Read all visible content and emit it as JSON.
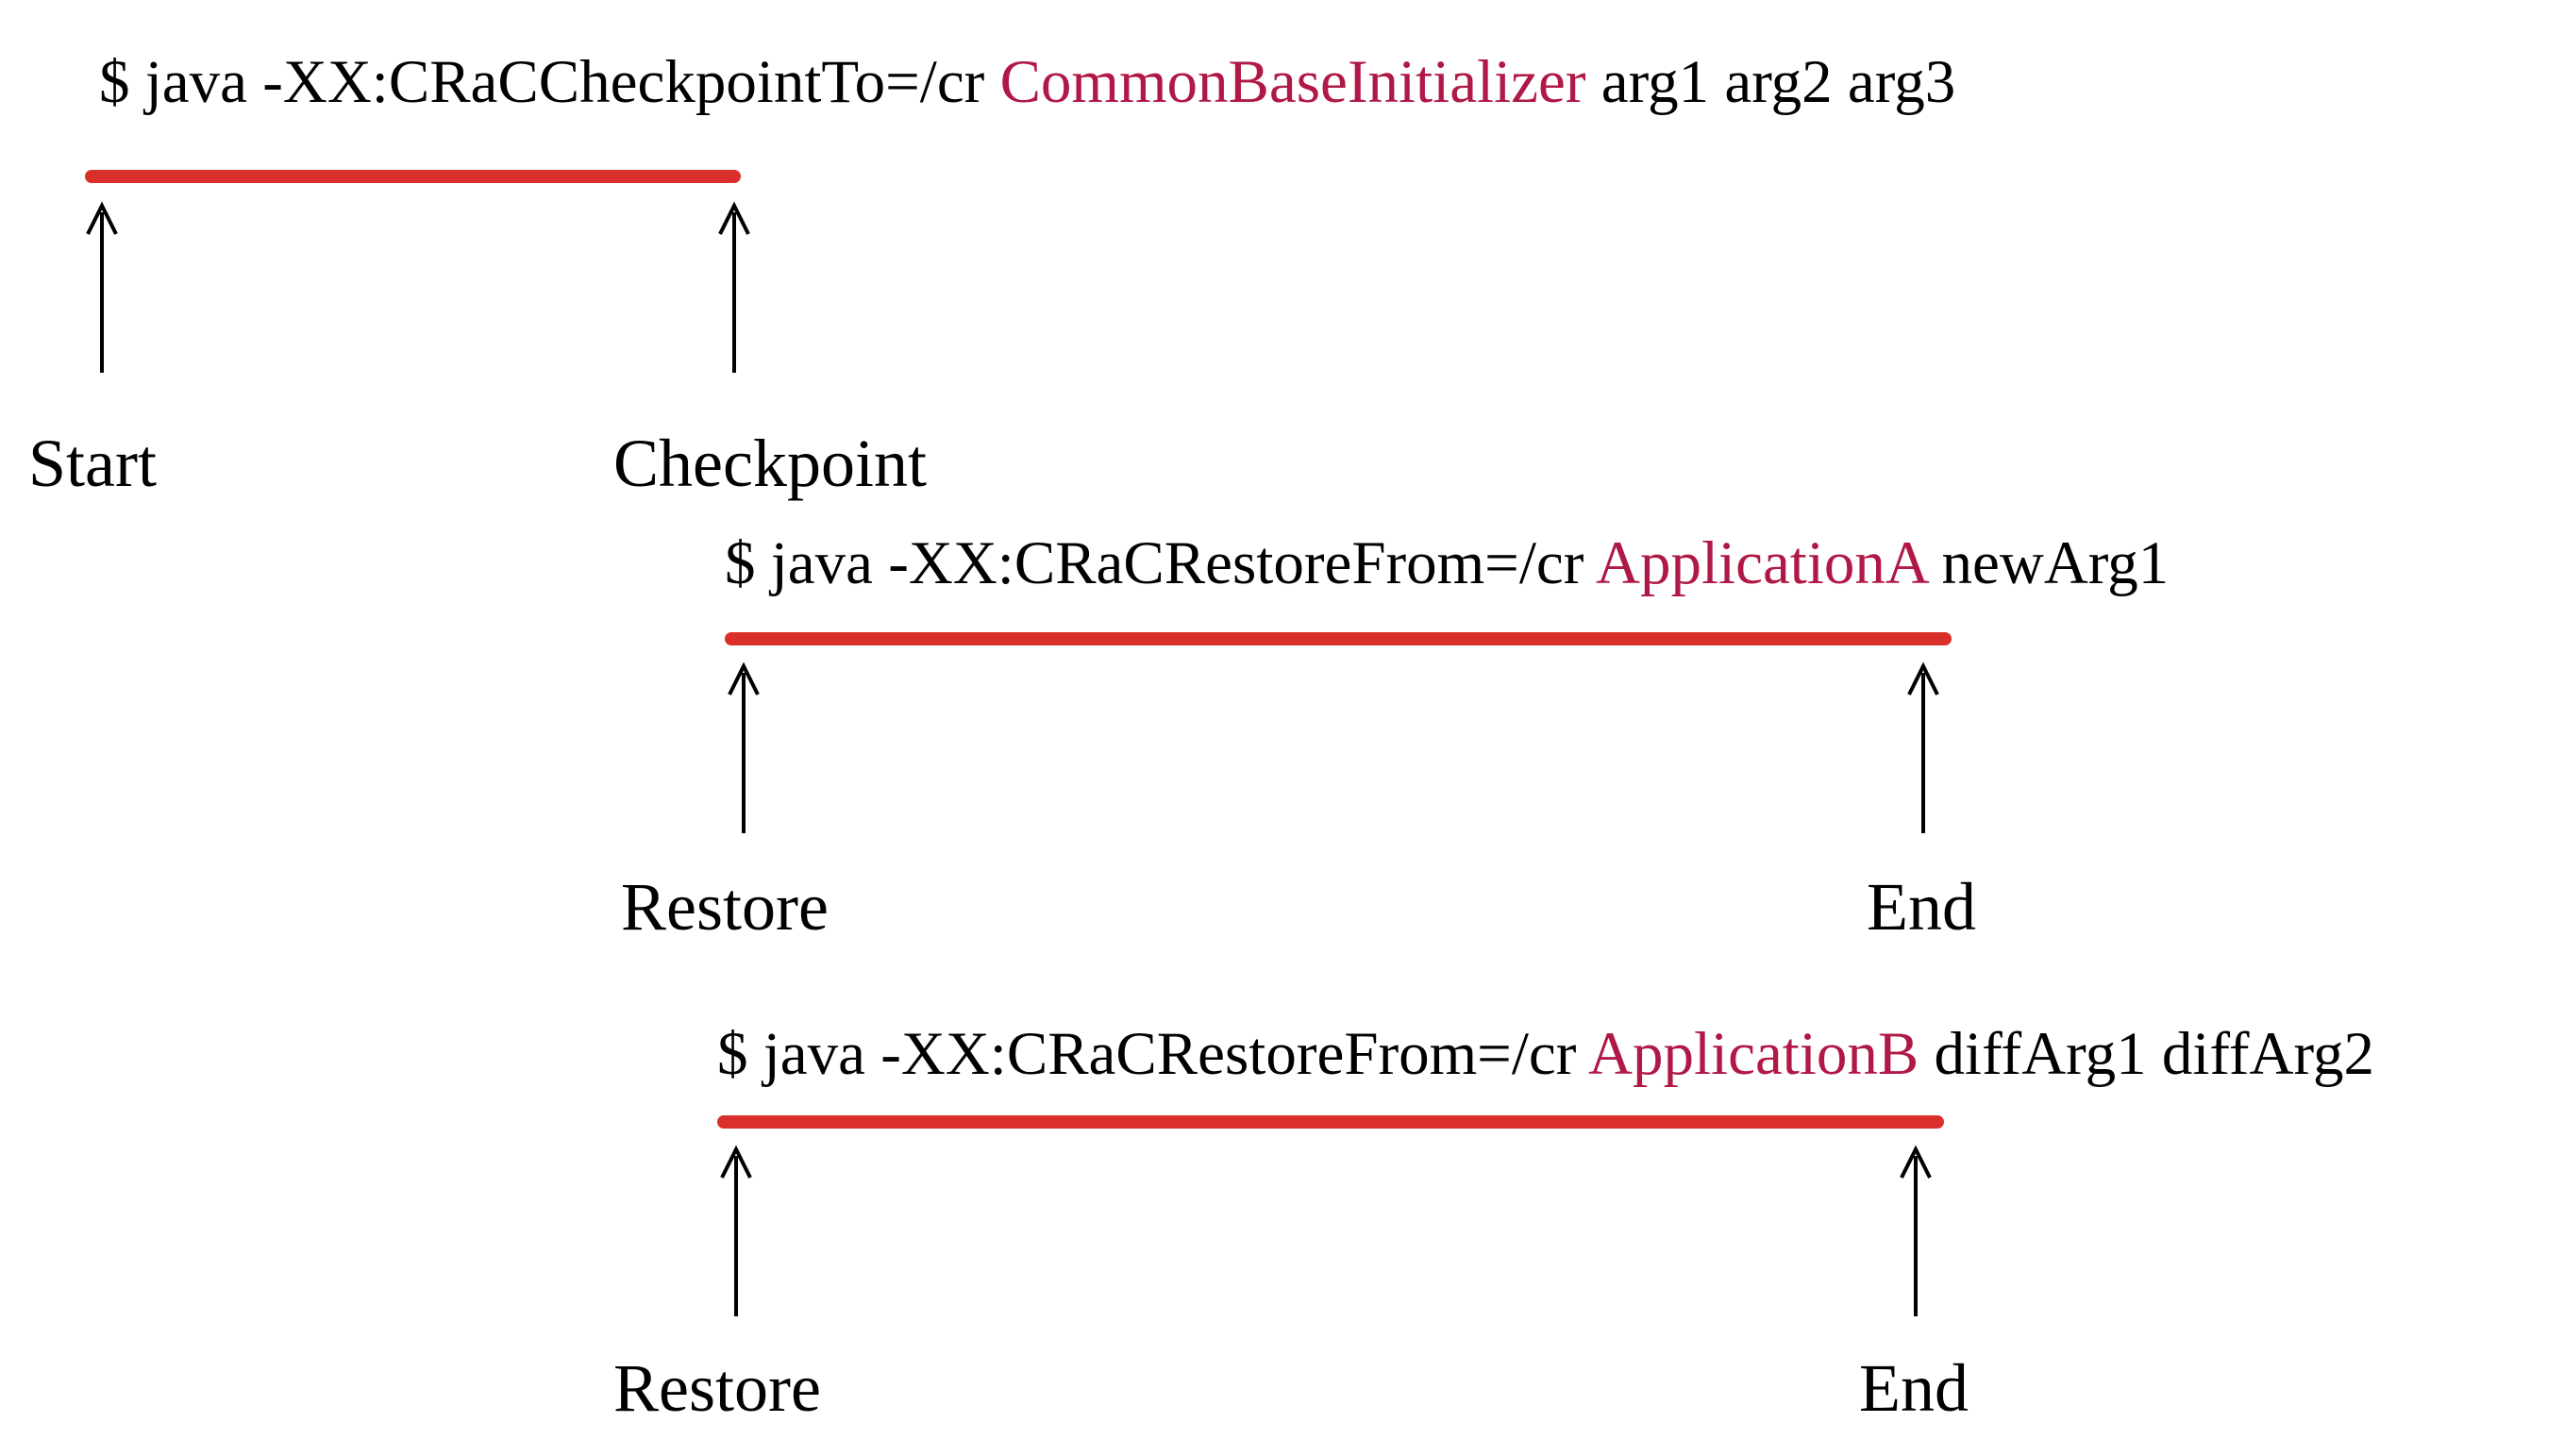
{
  "cmd1": {
    "prefix": "$ java -XX:CRaCCheckpointTo=/cr ",
    "highlight": "CommonBaseInitializer",
    "suffix": " arg1 arg2 arg3"
  },
  "cmd2": {
    "prefix": "$ java -XX:CRaCRestoreFrom=/cr ",
    "highlight": "ApplicationA",
    "suffix": " newArg1"
  },
  "cmd3": {
    "prefix": "$ java -XX:CRaCRestoreFrom=/cr ",
    "highlight": "ApplicationB",
    "suffix": " diffArg1 diffArg2"
  },
  "labels": {
    "start": "Start",
    "checkpoint": "Checkpoint",
    "restore1": "Restore",
    "end1": "End",
    "restore2": "Restore",
    "end2": "End"
  }
}
